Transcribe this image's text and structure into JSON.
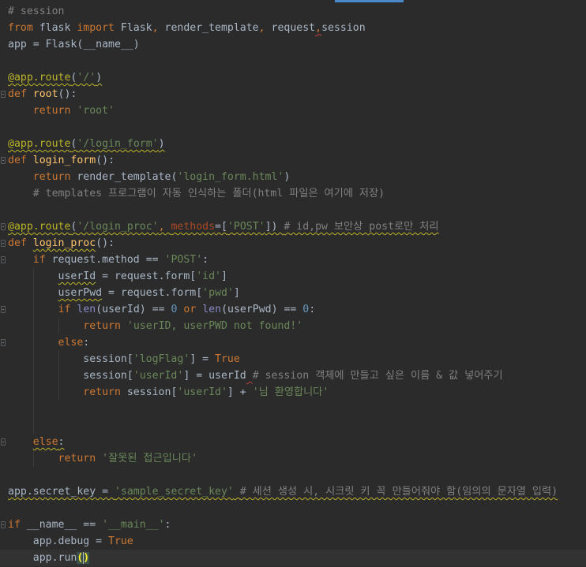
{
  "editor": {
    "colors": {
      "background": "#2b2b2b",
      "keyword": "#cc7832",
      "string": "#6a8759",
      "comment": "#808080",
      "function": "#ffc66d",
      "decorator": "#bbb529",
      "number": "#6897bb",
      "plain": "#a9b7c6"
    },
    "lines": [
      [
        {
          "t": "# session",
          "c": "cmt"
        }
      ],
      [
        {
          "t": "from",
          "c": "kw"
        },
        {
          "t": " flask ",
          "c": "plain"
        },
        {
          "t": "import",
          "c": "kw"
        },
        {
          "t": " Flask",
          "c": "plain"
        },
        {
          "t": ",",
          "c": "kw"
        },
        {
          "t": " render_template",
          "c": "plain"
        },
        {
          "t": ",",
          "c": "kw"
        },
        {
          "t": " request",
          "c": "plain"
        },
        {
          "t": ",",
          "c": "kw",
          "u": "warn"
        },
        {
          "t": "session",
          "c": "plain"
        }
      ],
      [
        {
          "t": "app = Flask(__name__)",
          "c": "plain"
        }
      ],
      [],
      [
        {
          "t": "@app.route",
          "c": "deco",
          "u": "wavy"
        },
        {
          "t": "(",
          "c": "plain",
          "u": "wavy"
        },
        {
          "t": "'/'",
          "c": "str",
          "u": "wavy"
        },
        {
          "t": ")",
          "c": "plain",
          "u": "wavy"
        }
      ],
      [
        {
          "t": "def",
          "c": "kw"
        },
        {
          "t": " ",
          "c": "plain"
        },
        {
          "t": "root",
          "c": "fn"
        },
        {
          "t": "():",
          "c": "plain"
        }
      ],
      [
        {
          "t": "    ",
          "c": "plain"
        },
        {
          "t": "return",
          "c": "kw"
        },
        {
          "t": " ",
          "c": "plain"
        },
        {
          "t": "'root'",
          "c": "str"
        }
      ],
      [],
      [
        {
          "t": "@app.route",
          "c": "deco",
          "u": "wavy"
        },
        {
          "t": "(",
          "c": "plain",
          "u": "wavy"
        },
        {
          "t": "'/login_form'",
          "c": "str",
          "u": "wavy"
        },
        {
          "t": ")",
          "c": "plain",
          "u": "wavy"
        }
      ],
      [
        {
          "t": "def",
          "c": "kw"
        },
        {
          "t": " ",
          "c": "plain"
        },
        {
          "t": "login_form",
          "c": "fn"
        },
        {
          "t": "():",
          "c": "plain"
        }
      ],
      [
        {
          "t": "    ",
          "c": "plain"
        },
        {
          "t": "return",
          "c": "kw"
        },
        {
          "t": " render_template(",
          "c": "plain"
        },
        {
          "t": "'login_form.html'",
          "c": "str"
        },
        {
          "t": ")",
          "c": "plain"
        }
      ],
      [
        {
          "t": "    ",
          "c": "plain"
        },
        {
          "t": "# templates 프로그램이 자동 인식하는 폴더(html 파일은 여기에 저장)",
          "c": "cmt"
        }
      ],
      [],
      [
        {
          "t": "@app.route",
          "c": "deco",
          "u": "wavy"
        },
        {
          "t": "(",
          "c": "plain",
          "u": "wavy"
        },
        {
          "t": "'/login_proc'",
          "c": "str",
          "u": "wavy"
        },
        {
          "t": ", ",
          "c": "kw",
          "u": "wavy"
        },
        {
          "t": "methods",
          "c": "param",
          "u": "wavy"
        },
        {
          "t": "=[",
          "c": "plain",
          "u": "wavy"
        },
        {
          "t": "'POST'",
          "c": "str",
          "u": "wavy"
        },
        {
          "t": "]) ",
          "c": "plain",
          "u": "wavy"
        },
        {
          "t": "# id,pw 보안상 post로만 처리",
          "c": "cmt",
          "u": "wavy"
        }
      ],
      [
        {
          "t": "def",
          "c": "kw"
        },
        {
          "t": " ",
          "c": "plain"
        },
        {
          "t": "login_proc",
          "c": "fn",
          "u": "wavy"
        },
        {
          "t": "():",
          "c": "plain"
        }
      ],
      [
        {
          "t": "    ",
          "c": "plain"
        },
        {
          "t": "if",
          "c": "kw"
        },
        {
          "t": " request.method == ",
          "c": "plain"
        },
        {
          "t": "'POST'",
          "c": "str"
        },
        {
          "t": ":",
          "c": "plain"
        }
      ],
      [
        {
          "t": "        ",
          "c": "plain"
        },
        {
          "t": "userId",
          "c": "plain",
          "u": "wavy"
        },
        {
          "t": " = request.form[",
          "c": "plain"
        },
        {
          "t": "'id'",
          "c": "str"
        },
        {
          "t": "]",
          "c": "plain"
        }
      ],
      [
        {
          "t": "        ",
          "c": "plain"
        },
        {
          "t": "userPwd",
          "c": "plain",
          "u": "wavy"
        },
        {
          "t": " = request.form[",
          "c": "plain"
        },
        {
          "t": "'pwd'",
          "c": "str"
        },
        {
          "t": "]",
          "c": "plain"
        }
      ],
      [
        {
          "t": "        ",
          "c": "plain"
        },
        {
          "t": "if",
          "c": "kw"
        },
        {
          "t": " ",
          "c": "plain"
        },
        {
          "t": "len",
          "c": "builtin"
        },
        {
          "t": "(userId) == ",
          "c": "plain"
        },
        {
          "t": "0",
          "c": "num"
        },
        {
          "t": " ",
          "c": "plain"
        },
        {
          "t": "or",
          "c": "kw"
        },
        {
          "t": " ",
          "c": "plain"
        },
        {
          "t": "len",
          "c": "builtin"
        },
        {
          "t": "(userPwd) == ",
          "c": "plain"
        },
        {
          "t": "0",
          "c": "num"
        },
        {
          "t": ":",
          "c": "plain"
        }
      ],
      [
        {
          "t": "            ",
          "c": "plain"
        },
        {
          "t": "return",
          "c": "kw"
        },
        {
          "t": " ",
          "c": "plain"
        },
        {
          "t": "'userID, userPWD not found!'",
          "c": "str"
        }
      ],
      [
        {
          "t": "        ",
          "c": "plain"
        },
        {
          "t": "else",
          "c": "kw"
        },
        {
          "t": ":",
          "c": "plain"
        }
      ],
      [
        {
          "t": "            session[",
          "c": "plain"
        },
        {
          "t": "'logFlag'",
          "c": "str"
        },
        {
          "t": "] = ",
          "c": "plain"
        },
        {
          "t": "True",
          "c": "kw"
        }
      ],
      [
        {
          "t": "            session[",
          "c": "plain"
        },
        {
          "t": "'userId'",
          "c": "str"
        },
        {
          "t": "] = userId",
          "c": "plain"
        },
        {
          "t": " ",
          "c": "plain",
          "u": "warn"
        },
        {
          "t": "# session 객체에 만들고 싶은 이름 & 값 넣어주기",
          "c": "cmt"
        }
      ],
      [
        {
          "t": "            ",
          "c": "plain"
        },
        {
          "t": "return",
          "c": "kw"
        },
        {
          "t": " session[",
          "c": "plain"
        },
        {
          "t": "'userId'",
          "c": "str"
        },
        {
          "t": "] + ",
          "c": "plain"
        },
        {
          "t": "'님 환영합니다'",
          "c": "str"
        }
      ],
      [],
      [],
      [
        {
          "t": "    ",
          "c": "plain"
        },
        {
          "t": "else",
          "c": "kw",
          "u": "wavy"
        },
        {
          "t": ":",
          "c": "plain",
          "u": "wavy"
        }
      ],
      [
        {
          "t": "        ",
          "c": "plain"
        },
        {
          "t": "return",
          "c": "kw"
        },
        {
          "t": " ",
          "c": "plain"
        },
        {
          "t": "'잘못된 접근입니다'",
          "c": "str"
        }
      ],
      [],
      [
        {
          "t": "app.secret_key = ",
          "c": "plain",
          "u": "wavy"
        },
        {
          "t": "'sample_secret_key'",
          "c": "str",
          "u": "wavy"
        },
        {
          "t": " ",
          "c": "plain",
          "u": "wavy"
        },
        {
          "t": "# 세션 생성 시, 시크릿 키 꼭 만들어줘야 함(임의의 문자열 입력)",
          "c": "cmt",
          "u": "wavy"
        }
      ],
      [],
      [
        {
          "t": "if",
          "c": "kw"
        },
        {
          "t": " __name__ == ",
          "c": "plain"
        },
        {
          "t": "'__main__'",
          "c": "str"
        },
        {
          "t": ":",
          "c": "plain"
        }
      ],
      [
        {
          "t": "    app.debug = ",
          "c": "plain"
        },
        {
          "t": "True",
          "c": "kw"
        }
      ],
      [
        {
          "t": "    app.run",
          "c": "plain"
        },
        {
          "t": "()",
          "c": "brace-hl"
        }
      ]
    ]
  }
}
